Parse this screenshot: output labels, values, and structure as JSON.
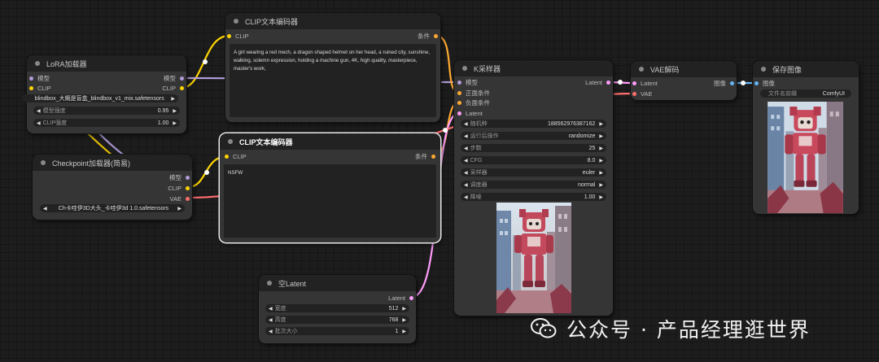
{
  "colors": {
    "model": "#b39ddb",
    "clip": "#ffd500",
    "conditioning": "#ffa931",
    "latent": "#ff9cf9",
    "vae": "#ff6e6e",
    "image": "#64b5f6"
  },
  "lora": {
    "title": "LoRA加载器",
    "inputs": [
      "模型",
      "CLIP"
    ],
    "outputs": [
      "模型",
      "CLIP"
    ],
    "lora_name": "blindbox_大概是盲盒_blindbox_v1_mix.safetensors",
    "model_strength_label": "模型强度",
    "model_strength": "0.95",
    "clip_strength_label": "CLIP强度",
    "clip_strength": "1.00"
  },
  "checkpoint": {
    "title": "Checkpoint加载器(简易)",
    "outputs": [
      "模型",
      "CLIP",
      "VAE"
    ],
    "ckpt_name": "Ch卡哇伊3D大头_卡哇伊3d 1.0.safetensors"
  },
  "clip_pos": {
    "title": "CLIP文本编码器",
    "input": "CLIP",
    "output": "条件",
    "text": "A girl wearing a red mech, a dragon shaped helmet on her head, a ruined city, sunshine, walking, solemn expression, holding a machine gun, 4K, high quality, masterpiece, master's work,"
  },
  "clip_neg": {
    "title": "CLIP文本编码器",
    "input": "CLIP",
    "output": "条件",
    "text": "NSFW"
  },
  "empty_latent": {
    "title": "空Latent",
    "output": "Latent",
    "width_label": "宽度",
    "width": "512",
    "height_label": "高度",
    "height": "768",
    "batch_label": "批次大小",
    "batch": "1"
  },
  "ksampler": {
    "title": "K采样器",
    "inputs": [
      "模型",
      "正面条件",
      "负面条件",
      "Latent"
    ],
    "output": "Latent",
    "widgets": [
      {
        "label": "随机种",
        "value": "188562976387162"
      },
      {
        "label": "运行后操作",
        "value": "randomize"
      },
      {
        "label": "步数",
        "value": "25"
      },
      {
        "label": "CFG",
        "value": "8.0"
      },
      {
        "label": "采样器",
        "value": "euler"
      },
      {
        "label": "调度器",
        "value": "normal"
      },
      {
        "label": "降噪",
        "value": "1.00"
      }
    ]
  },
  "vae_decode": {
    "title": "VAE解码",
    "inputs": [
      "Latent",
      "VAE"
    ],
    "output": "图像"
  },
  "save_image": {
    "title": "保存图像",
    "input": "图像",
    "filename_label": "文件名前缀",
    "filename": "ComfyUI"
  },
  "watermark": {
    "text": "公众号 · 产品经理逛世界"
  }
}
